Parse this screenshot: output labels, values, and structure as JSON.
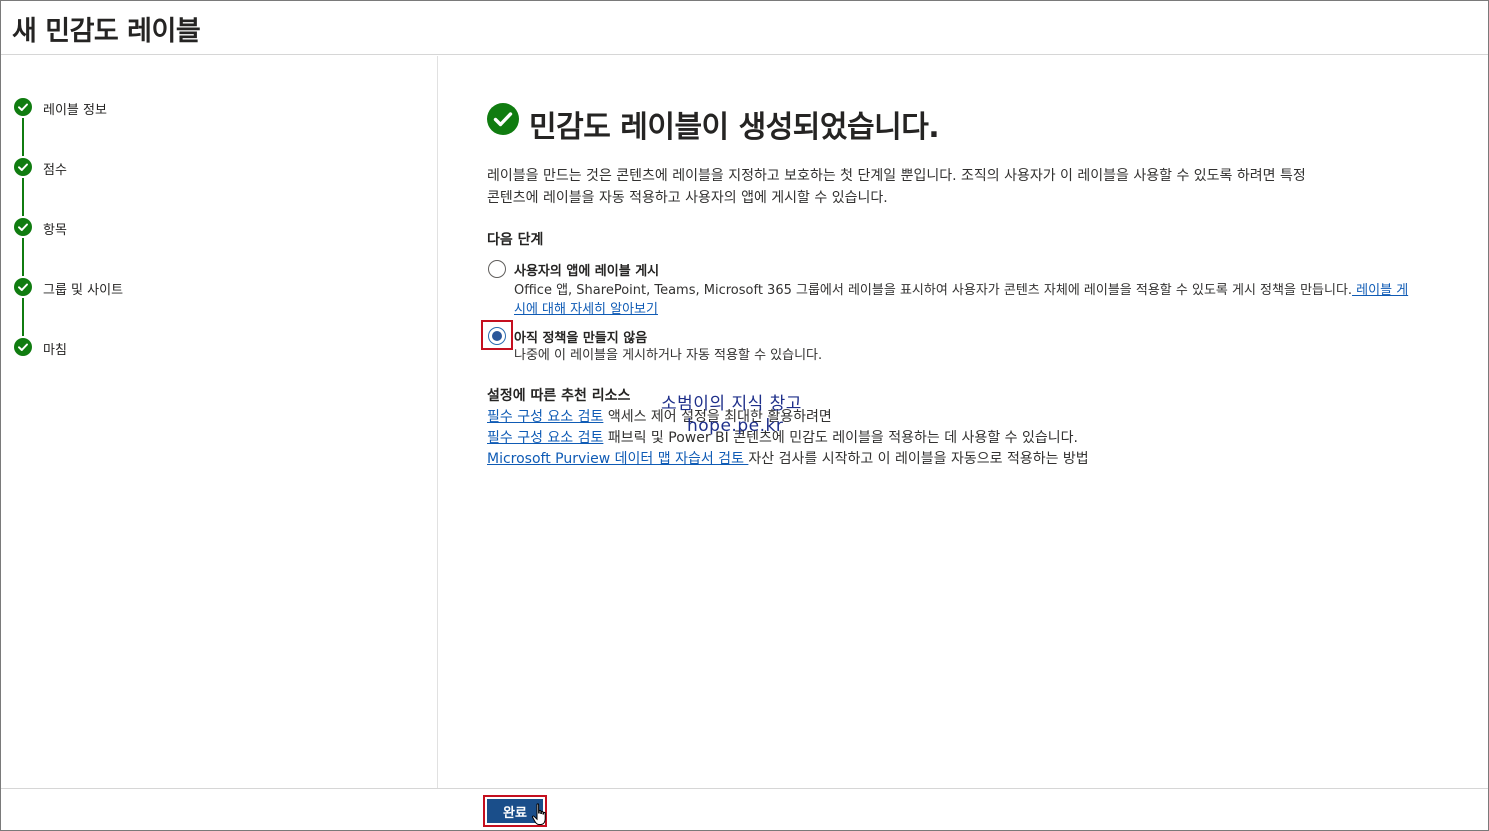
{
  "window": {
    "title": "새 민감도 레이블"
  },
  "steps": [
    {
      "label": "레이블 정보",
      "status": "complete"
    },
    {
      "label": "점수",
      "status": "complete"
    },
    {
      "label": "항목",
      "status": "complete"
    },
    {
      "label": "그룹 및 사이트",
      "status": "complete"
    },
    {
      "label": "마침",
      "status": "complete"
    }
  ],
  "main": {
    "success_title": "민감도 레이블이 생성되었습니다.",
    "description_line1": "레이블을 만드는 것은 콘텐츠에 레이블을 지정하고 보호하는 첫 단계일 뿐입니다. 조직의 사용자가 이 레이블을 사용할 수 있도록 하려면 특정",
    "description_line2": "콘텐츠에 레이블을 자동 적용하고 사용자의 앱에 게시할 수 있습니다.",
    "next_steps_heading": "다음 단계",
    "options": [
      {
        "title": "사용자의 앱에 레이블 게시",
        "sub_line1": "Office 앱, SharePoint, Teams, Microsoft 365 그룹에서 레이블을 표시하여 사용자가 콘텐츠 자체에 레이블을 적용할 수 있도록 게시 정책을 만듭니다.",
        "link_part1": " 레이블 게",
        "link_part2": "시에 대해 자세히 알아보기",
        "checked": false
      },
      {
        "title": "아직 정책을 만들지 않음",
        "sub_line1": "나중에 이 레이블을 게시하거나 자동 적용할 수 있습니다.",
        "checked": true
      }
    ],
    "resources_heading": "설정에 따른 추천 리소스",
    "resources": [
      {
        "link": "필수 구성 요소 검토",
        "text": " 액세스 제어 설정을 최대한 활용하려면"
      },
      {
        "link": "필수 구성 요소 검토",
        "text": " 패브릭 및 Power BI 콘텐츠에 민감도 레이블을 적용하는 데 사용할 수 있습니다."
      },
      {
        "link": "Microsoft Purview 데이터 맵 자습서 검토 ",
        "text": "자산 검사를 시작하고 이 레이블을 자동으로 적용하는 방법"
      }
    ]
  },
  "watermark": {
    "line1": "소범이의 지식 창고",
    "line2": "hope.pe.kr"
  },
  "footer": {
    "done_label": "완료"
  },
  "colors": {
    "accent": "#1a4e8a",
    "success": "#107c10",
    "link": "#0f5bb5",
    "highlight": "#c50f1f"
  },
  "icons": {
    "step_check": "check-circle-icon",
    "success_check": "check-circle-icon",
    "cursor": "hand-pointer-icon"
  }
}
